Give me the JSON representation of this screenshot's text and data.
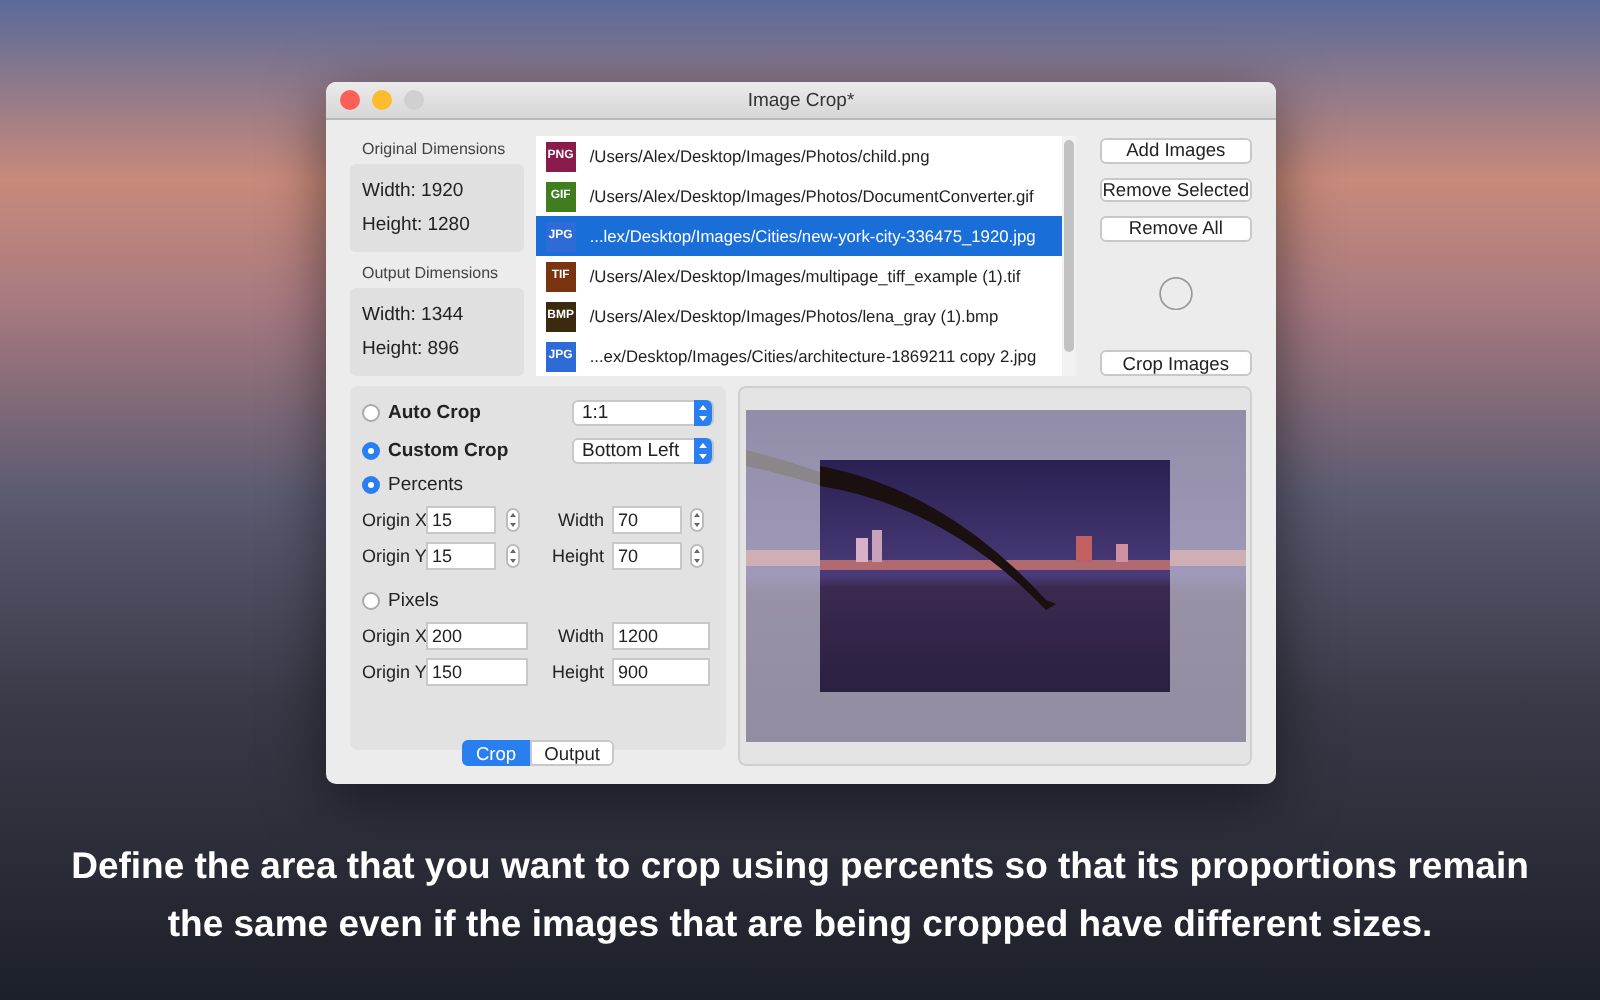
{
  "window": {
    "title": "Image Crop*"
  },
  "dimension_panels": [
    {
      "title": "Original Dimensions",
      "width": "Width: 1920",
      "height": "Height: 1280"
    },
    {
      "title": "Output Dimensions",
      "width": "Width: 1344",
      "height": "Height: 896"
    }
  ],
  "files": [
    {
      "type": "PNG",
      "color": "#8a1c4c",
      "path": "/Users/Alex/Desktop/Images/Photos/child.png",
      "selected": false
    },
    {
      "type": "GIF",
      "color": "#3f7d1f",
      "path": "/Users/Alex/Desktop/Images/Photos/DocumentConverter.gif",
      "selected": false
    },
    {
      "type": "JPG",
      "color": "#2f6bd6",
      "path": "...lex/Desktop/Images/Cities/new-york-city-336475_1920.jpg",
      "selected": true
    },
    {
      "type": "TIF",
      "color": "#7a3410",
      "path": "/Users/Alex/Desktop/Images/multipage_tiff_example (1).tif",
      "selected": false
    },
    {
      "type": "BMP",
      "color": "#3a2a10",
      "path": "/Users/Alex/Desktop/Images/Photos/lena_gray (1).bmp",
      "selected": false
    },
    {
      "type": "JPG",
      "color": "#2f6bd6",
      "path": "...ex/Desktop/Images/Cities/architecture-1869211 copy 2.jpg",
      "selected": false
    }
  ],
  "buttons": [
    "Add Images",
    "Remove Selected",
    "Remove All"
  ],
  "crop_button": "Crop Images",
  "crop_modes": [
    {
      "label": "Auto Crop",
      "selected": false,
      "dropdown": "1:1"
    },
    {
      "label": "Custom Crop",
      "selected": true,
      "dropdown": "Bottom Left"
    }
  ],
  "units": [
    {
      "label": "Percents",
      "selected": true,
      "kind": "stepper",
      "fields": [
        {
          "label": "Origin X",
          "value": "15"
        },
        {
          "label": "Width",
          "value": "70"
        },
        {
          "label": "Origin Y",
          "value": "15"
        },
        {
          "label": "Height",
          "value": "70"
        }
      ]
    },
    {
      "label": "Pixels",
      "selected": false,
      "kind": "plain",
      "fields": [
        {
          "label": "Origin X",
          "value": "200"
        },
        {
          "label": "Width",
          "value": "1200"
        },
        {
          "label": "Origin Y",
          "value": "150"
        },
        {
          "label": "Height",
          "value": "900"
        }
      ]
    }
  ],
  "tabs": [
    {
      "label": "Crop",
      "selected": true
    },
    {
      "label": "Output",
      "selected": false
    }
  ],
  "caption": "Define the area that you want to crop using percents so that its proportions remain the same even if the images that are being cropped have different sizes."
}
